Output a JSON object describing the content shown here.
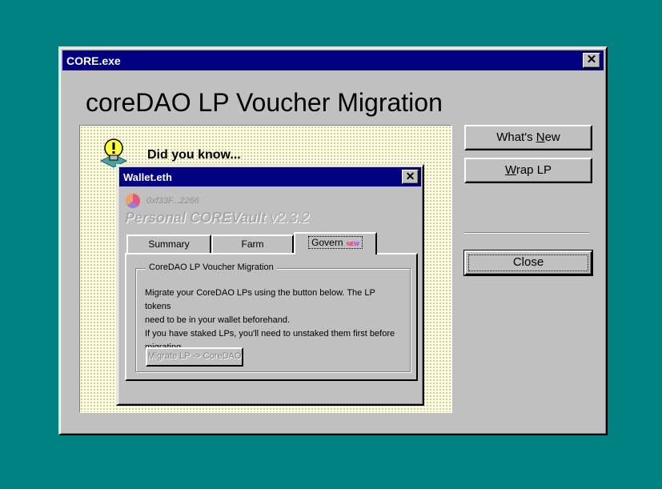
{
  "main_window": {
    "title": "CORE.exe",
    "close_glyph": "✕",
    "heading": "coreDAO LP Voucher Migration",
    "did_you_know": "Did you know...",
    "buttons": {
      "whats_new_prefix": "What's ",
      "whats_new_underlined": "N",
      "whats_new_suffix": "ew",
      "wrap_underlined": "W",
      "wrap_suffix": "rap LP",
      "close": "Close"
    }
  },
  "wallet_window": {
    "title": "Wallet.eth",
    "close_glyph": "✕",
    "address": "0xf33F...2266",
    "vault_name": "Personal COREVault",
    "vault_version": "v2.3.2",
    "tabs": [
      {
        "label": "Summary"
      },
      {
        "label": "Farm"
      },
      {
        "label": "Govern",
        "badge": "NEW",
        "active": true
      }
    ],
    "group_title": "CoreDAO LP Voucher Migration",
    "lines": [
      "Migrate your CoreDAO LPs using the button below. The LP tokens",
      "need to be in your wallet beforehand.",
      "If you have staked LPs, you'll need to unstaked them first before",
      "migrating."
    ],
    "migrate_button": "Migrate LP -> CoreDAO"
  },
  "colors": {
    "desktop": "#008080",
    "titlebar": "#000080",
    "window": "#c0c0c0",
    "tip_panel": "#ffffe0"
  },
  "icons": [
    "close-icon",
    "lightbulb-icon",
    "wallet-logo-icon"
  ]
}
